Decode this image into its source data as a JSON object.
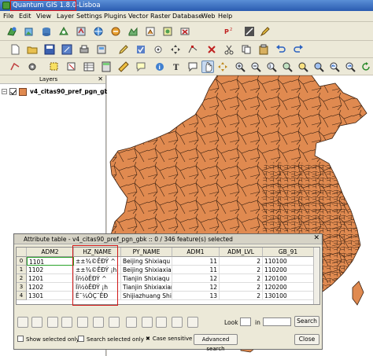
{
  "window": {
    "title": "Quantum GIS 1.8.0-Lisboa"
  },
  "menu": [
    "File",
    "Edit",
    "View",
    "Layer",
    "Settings",
    "Plugins",
    "Vector",
    "Raster",
    "Database",
    "Web",
    "Help"
  ],
  "layers_panel": {
    "title": "Layers",
    "layer_name": "v4_citas90_pref_pgn_gbk",
    "layer_color": "#e08a50"
  },
  "map": {
    "fill_color": "#e08a50",
    "stroke_color": "#3a2010"
  },
  "attribute_table": {
    "title": "Attribute table - v4_citas90_pref_pgn_gbk :: 0 / 346 feature(s) selected",
    "columns": [
      "ADM2",
      "HZ_NAME",
      "PY_NAME",
      "ADM1",
      "ADM_LVL",
      "GB_91"
    ],
    "rows": [
      {
        "index": "0",
        "ADM2": "1101",
        "HZ_NAME": "±±¾©ÊÐÝ ^",
        "PY_NAME": "Beijing  Shixiaqu",
        "ADM1": "11",
        "ADM_LVL": "2",
        "GB_91": "110100"
      },
      {
        "index": "1",
        "ADM2": "1102",
        "HZ_NAME": "±±¾©ÊÐÝ ¡h",
        "PY_NAME": "Beijing  Shixiaxian",
        "ADM1": "11",
        "ADM_LVL": "2",
        "GB_91": "110200"
      },
      {
        "index": "2",
        "ADM2": "1201",
        "HZ_NAME": "Ìì½òÊÐÝ ^",
        "PY_NAME": "Tianjin  Shixiaqu",
        "ADM1": "12",
        "ADM_LVL": "2",
        "GB_91": "120100"
      },
      {
        "index": "3",
        "ADM2": "1202",
        "HZ_NAME": "Ìì½òÊÐÝ ¡h",
        "PY_NAME": "Tianjin  Shixiaxian",
        "ADM1": "12",
        "ADM_LVL": "2",
        "GB_91": "120200"
      },
      {
        "index": "4",
        "ADM2": "1301",
        "HZ_NAME": "Ê¯¼ÒÇ¯ÊÐ",
        "PY_NAME": "Shijiazhuang  Shi",
        "ADM1": "13",
        "ADM_LVL": "2",
        "GB_91": "130100"
      }
    ],
    "look_for_label": "Look for",
    "in_label": "in",
    "search_label": "Search",
    "show_selected_label": "Show selected only",
    "search_selected_label": "Search selected only",
    "case_sensitive_label": "Case sensitive",
    "advanced_search_label": "Advanced search",
    "close_label": "Close"
  }
}
